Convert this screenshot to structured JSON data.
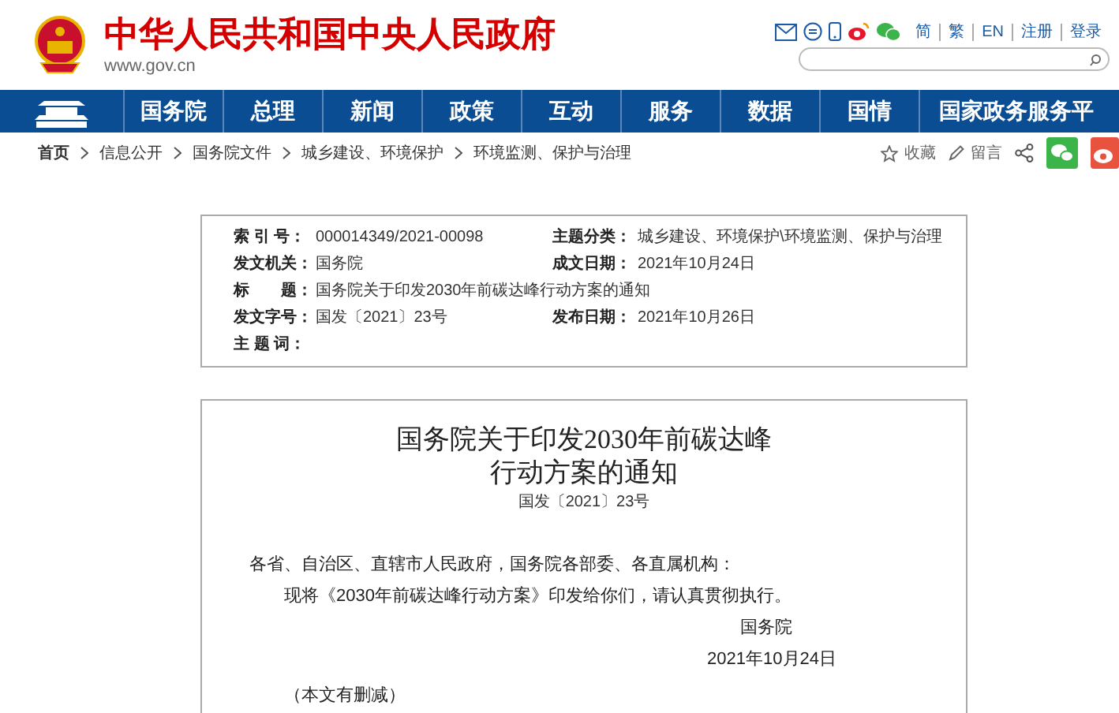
{
  "header": {
    "title": "中华人民共和国中央人民政府",
    "domain": "www.gov.cn",
    "links": [
      "简",
      "繁",
      "EN",
      "注册",
      "登录"
    ]
  },
  "nav": {
    "items": [
      "国务院",
      "总理",
      "新闻",
      "政策",
      "互动",
      "服务",
      "数据",
      "国情",
      "国家政务服务平"
    ]
  },
  "breadcrumb": {
    "items": [
      "首页",
      "信息公开",
      "国务院文件",
      "城乡建设、环境保护",
      "环境监测、保护与治理"
    ],
    "actions": [
      "收藏",
      "留言"
    ]
  },
  "info": {
    "rows": [
      [
        {
          "label": "索 引 号：",
          "value": "000014349/2021-00098"
        },
        {
          "label": "主题分类：",
          "value": "城乡建设、环境保护\\环境监测、保护与治理"
        }
      ],
      [
        {
          "label": "发文机关：",
          "value": "国务院"
        },
        {
          "label": "成文日期：",
          "value": "2021年10月24日"
        }
      ],
      [
        {
          "label": "标　　题：",
          "value": "国务院关于印发2030年前碳达峰行动方案的通知"
        }
      ],
      [
        {
          "label": "发文字号：",
          "value": "国发〔2021〕23号"
        },
        {
          "label": "发布日期：",
          "value": "2021年10月26日"
        }
      ],
      [
        {
          "label": "主 题 词："
        }
      ]
    ]
  },
  "document": {
    "title_lines": [
      "国务院关于印发2030年前碳达峰",
      "行动方案的通知"
    ],
    "doc_number": "国发〔2021〕23号",
    "salutation": "各省、自治区、直辖市人民政府，国务院各部委、各直属机构：",
    "body": "现将《2030年前碳达峰行动方案》印发给你们，请认真贯彻执行。",
    "signature": "国务院",
    "date": "2021年10月24日",
    "note": "（本文有删减）"
  }
}
